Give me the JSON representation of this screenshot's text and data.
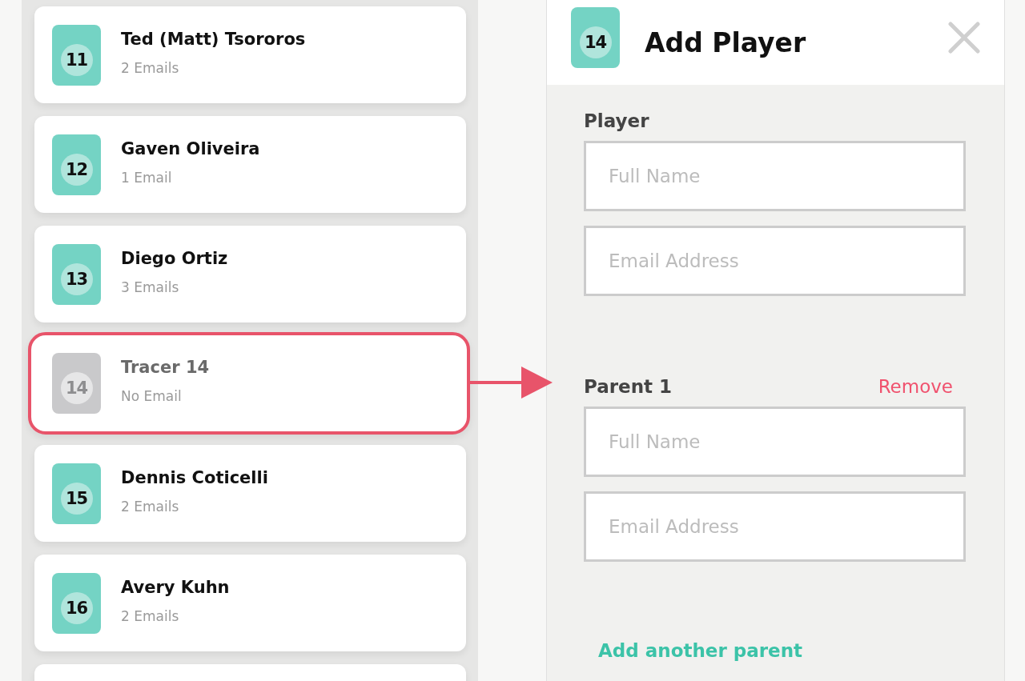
{
  "players": [
    {
      "number": "11",
      "name": "Ted (Matt) Tsororos",
      "emails": "2 Emails",
      "selected": false
    },
    {
      "number": "12",
      "name": "Gaven Oliveira",
      "emails": "1 Email",
      "selected": false
    },
    {
      "number": "13",
      "name": "Diego Ortiz",
      "emails": "3 Emails",
      "selected": false
    },
    {
      "number": "14",
      "name": "Tracer 14",
      "emails": "No Email",
      "selected": true
    },
    {
      "number": "15",
      "name": "Dennis Coticelli",
      "emails": "2 Emails",
      "selected": false
    },
    {
      "number": "16",
      "name": "Avery Kuhn",
      "emails": "2 Emails",
      "selected": false
    }
  ],
  "panel": {
    "badge": "14",
    "title": "Add Player",
    "sections": [
      {
        "label": "Player",
        "fields": [
          {
            "placeholder": "Full Name"
          },
          {
            "placeholder": "Email Address"
          }
        ]
      },
      {
        "label": "Parent 1",
        "action": "Remove",
        "fields": [
          {
            "placeholder": "Full Name"
          },
          {
            "placeholder": "Email Address"
          }
        ]
      }
    ],
    "add_link": "Add another parent"
  }
}
